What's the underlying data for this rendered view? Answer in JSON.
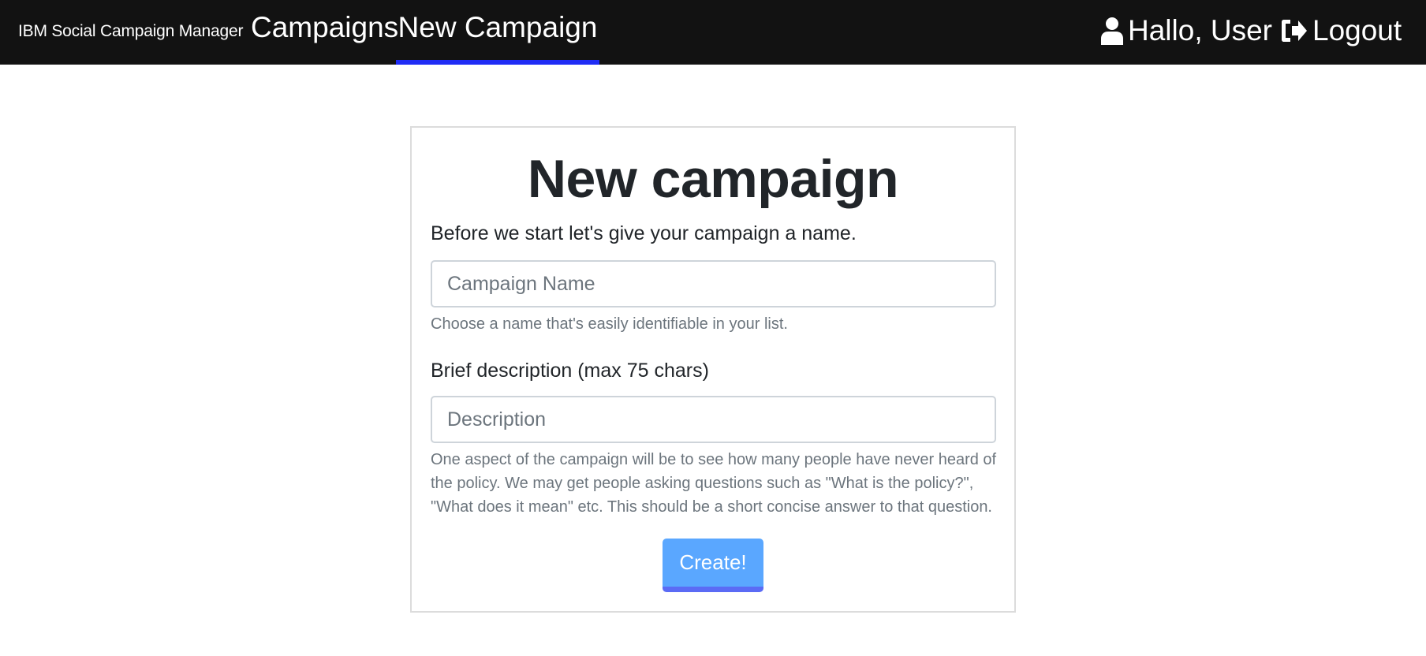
{
  "navbar": {
    "brand": "IBM Social Campaign Manager",
    "items": [
      {
        "label": "Campaigns"
      },
      {
        "label": "New Campaign",
        "active": true
      }
    ],
    "user_greeting": "Hallo, User",
    "logout_label": "Logout",
    "user_icon": "user-icon",
    "logout_icon": "sign-out-icon",
    "active_underline_color": "#1f2cf5"
  },
  "form": {
    "title": "New campaign",
    "name_label": "Before we start let's give your campaign a name.",
    "name_placeholder": "Campaign Name",
    "name_value": "",
    "name_help": "Choose a name that's easily identifiable in your list.",
    "desc_label": "Brief description (max 75 chars)",
    "desc_placeholder": "Description",
    "desc_value": "",
    "desc_help": "One aspect of the campaign will be to see how many people have never heard of the policy. We may get people asking questions such as \"What is the policy?\", \"What does it mean\" etc. This should be a short concise answer to that question.",
    "submit_label": "Create!",
    "submit_color": "#5aa7ff"
  }
}
